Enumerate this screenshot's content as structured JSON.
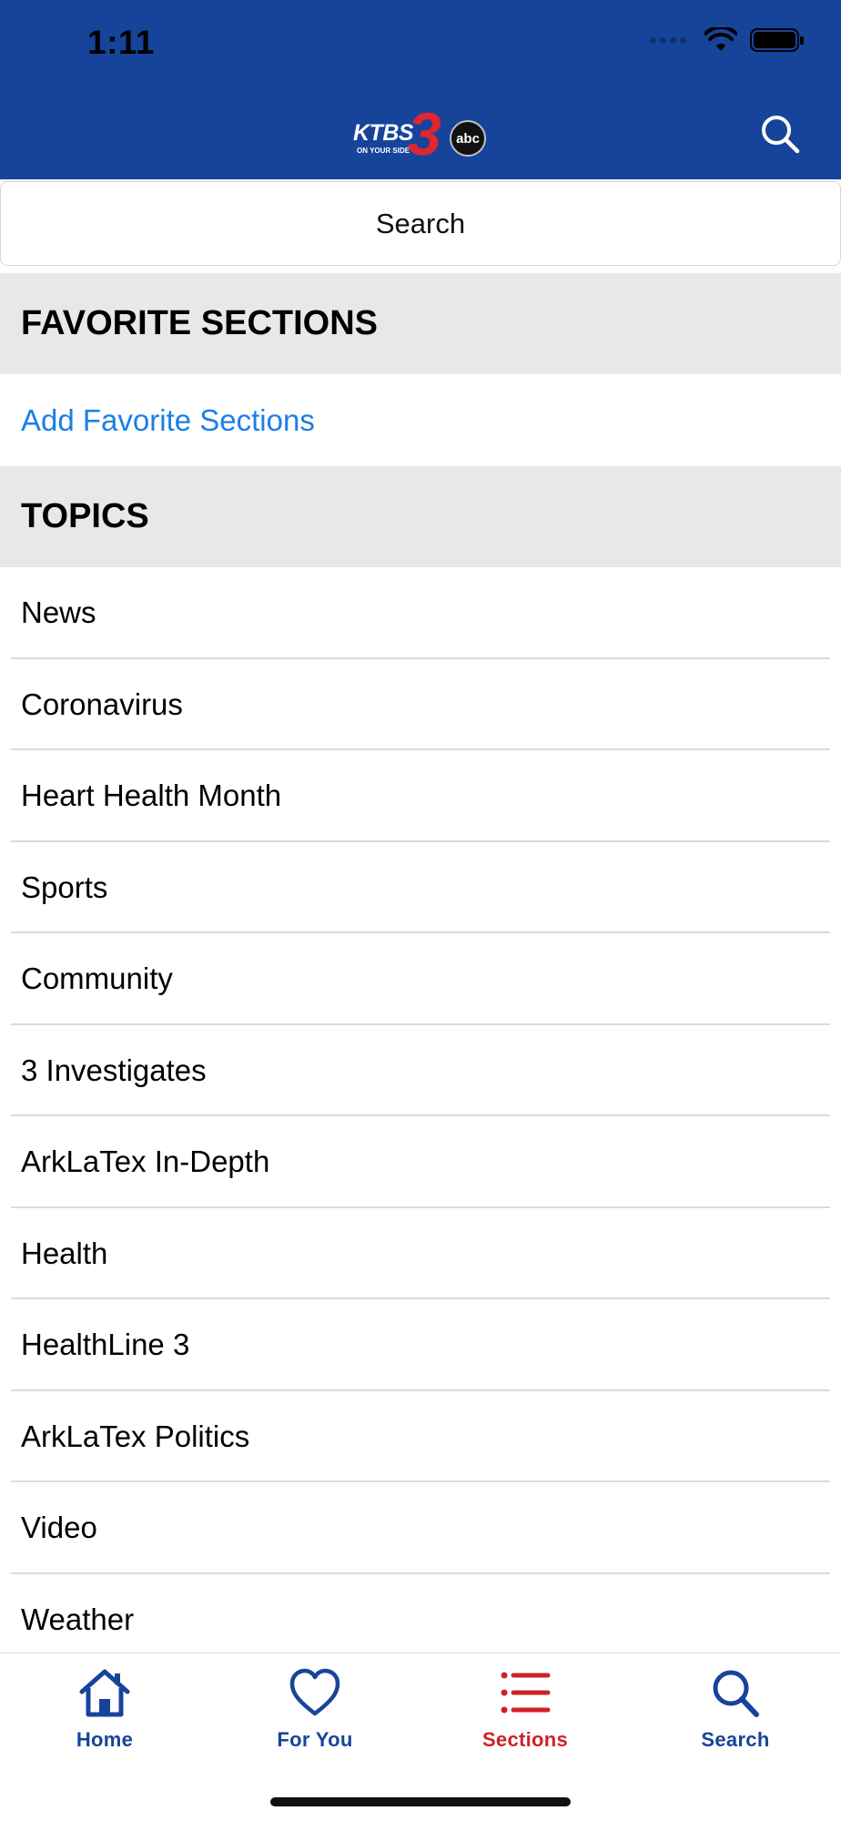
{
  "status_bar": {
    "time": "1:11"
  },
  "header": {
    "logo": {
      "text": "KTBS",
      "number": "3",
      "network": "abc",
      "tagline": "ON YOUR SIDE"
    },
    "colors": {
      "background": "#17449b",
      "accent_red": "#e0262e"
    },
    "search_icon": "search-icon"
  },
  "search": {
    "placeholder": "Search"
  },
  "favorites": {
    "heading": "FAVORITE SECTIONS",
    "add_label": "Add Favorite Sections",
    "link_color": "#1a7fe6"
  },
  "topics": {
    "heading": "TOPICS",
    "items": [
      {
        "label": "News"
      },
      {
        "label": "Coronavirus"
      },
      {
        "label": "Heart Health Month"
      },
      {
        "label": "Sports"
      },
      {
        "label": "Community"
      },
      {
        "label": "3 Investigates"
      },
      {
        "label": "ArkLaTex In-Depth"
      },
      {
        "label": "Health"
      },
      {
        "label": "HealthLine 3"
      },
      {
        "label": "ArkLaTex Politics"
      },
      {
        "label": "Video"
      },
      {
        "label": "Weather"
      }
    ]
  },
  "tabbar": {
    "active_color": "#d0202a",
    "inactive_color": "#17449b",
    "tabs": [
      {
        "label": "Home",
        "icon": "home-icon",
        "active": false
      },
      {
        "label": "For You",
        "icon": "heart-icon",
        "active": false
      },
      {
        "label": "Sections",
        "icon": "list-icon",
        "active": true
      },
      {
        "label": "Search",
        "icon": "search-icon",
        "active": false
      }
    ]
  }
}
